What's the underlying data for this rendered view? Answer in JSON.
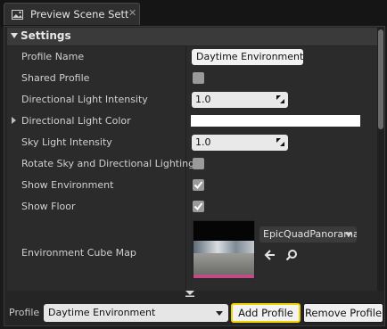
{
  "tab": {
    "title": "Preview Scene Setti",
    "close_glyph": "✕"
  },
  "section": {
    "title": "Settings"
  },
  "properties": {
    "profile_name": {
      "label": "Profile Name",
      "value": "Daytime Environment"
    },
    "shared_profile": {
      "label": "Shared Profile",
      "checked": false
    },
    "directional_light_intensity": {
      "label": "Directional Light Intensity",
      "value": "1.0"
    },
    "directional_light_color": {
      "label": "Directional Light Color",
      "color": "#ffffff"
    },
    "sky_light_intensity": {
      "label": "Sky Light Intensity",
      "value": "1.0"
    },
    "rotate_sky": {
      "label": "Rotate Sky and Directional Lighting",
      "checked": false
    },
    "show_environment": {
      "label": "Show Environment",
      "checked": true
    },
    "show_floor": {
      "label": "Show Floor",
      "checked": true
    },
    "environment_cube_map": {
      "label": "Environment Cube Map",
      "asset": "EpicQuadPanorama"
    }
  },
  "footer": {
    "profile_label": "Profile",
    "profile_selected": "Daytime Environment",
    "add_button": "Add Profile",
    "remove_button": "Remove Profile"
  },
  "colors": {
    "highlight_border": "#f1d500",
    "panel_bg": "#252525"
  }
}
